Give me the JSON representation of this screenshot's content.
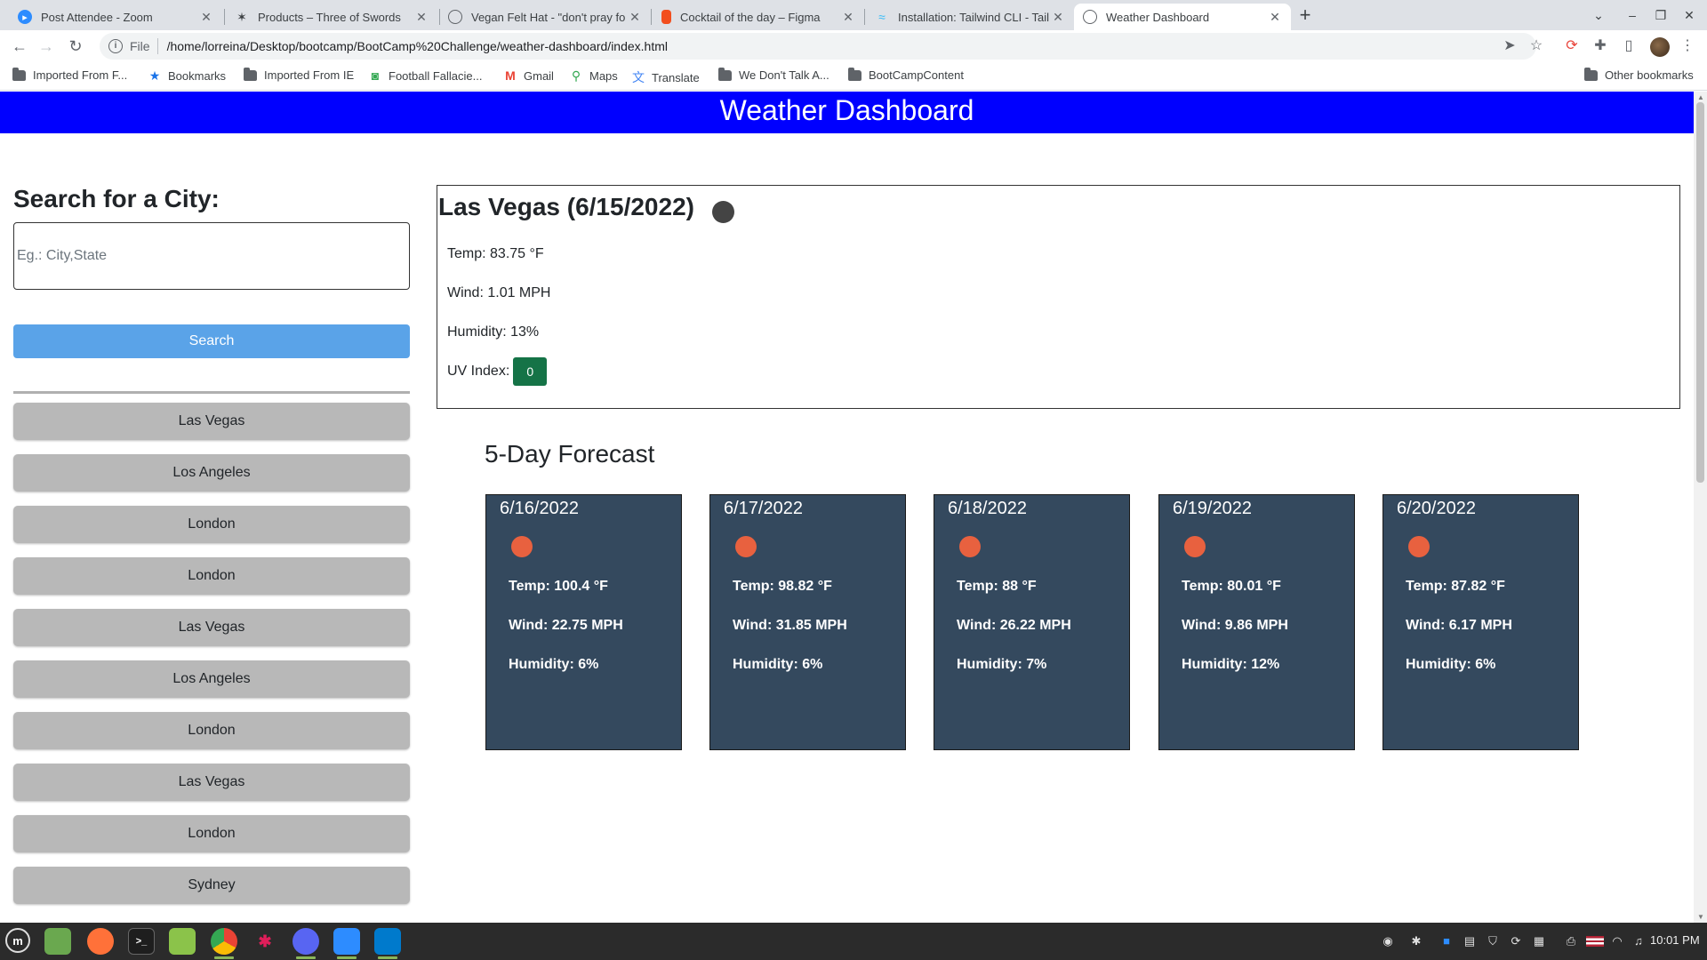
{
  "browser": {
    "tabs": [
      {
        "title": "Post Attendee - Zoom",
        "icon": "zoom-icon",
        "color": "#2d8cff",
        "active": false
      },
      {
        "title": "Products – Three of Swords",
        "icon": "swords-icon",
        "color": "#3c4043",
        "active": false
      },
      {
        "title": "Vegan Felt Hat - \"don't pray fo",
        "icon": "globe-icon",
        "color": "#5f6368",
        "active": false
      },
      {
        "title": "Cocktail of the day – Figma",
        "icon": "figma-icon",
        "color": "#f24e1e",
        "active": false
      },
      {
        "title": "Installation: Tailwind CLI - Tail",
        "icon": "tailwind-icon",
        "color": "#38bdf8",
        "active": false
      },
      {
        "title": "Weather Dashboard",
        "icon": "globe-icon",
        "color": "#5f6368",
        "active": true
      }
    ],
    "url_scheme": "File",
    "url": "/home/lorreina/Desktop/bootcamp/BootCamp%20Challenge/weather-dashboard/index.html",
    "bookmarks": [
      {
        "label": "Imported From F...",
        "icon": "folder-icon"
      },
      {
        "label": "Bookmarks",
        "icon": "star-icon"
      },
      {
        "label": "Imported From IE",
        "icon": "folder-icon"
      },
      {
        "label": "Football Fallacie...",
        "icon": "football-icon"
      },
      {
        "label": "Gmail",
        "icon": "gmail-icon"
      },
      {
        "label": "Maps",
        "icon": "maps-icon"
      },
      {
        "label": "Translate",
        "icon": "translate-icon"
      },
      {
        "label": "We Don't Talk A...",
        "icon": "folder-icon"
      },
      {
        "label": "BootCampContent",
        "icon": "folder-icon"
      }
    ],
    "other_bookmarks": "Other bookmarks"
  },
  "page": {
    "header_title": "Weather Dashboard",
    "header_color": "#0000ff",
    "search": {
      "title": "Search for a City:",
      "placeholder": "Eg.: City,State",
      "button_label": "Search"
    },
    "history": [
      "Las Vegas",
      "Los Angeles",
      "London",
      "London",
      "Las Vegas",
      "Los Angeles",
      "London",
      "Las Vegas",
      "London",
      "Sydney"
    ],
    "current": {
      "title": "Las Vegas (6/15/2022)",
      "temp": "Temp: 83.75 °F",
      "wind": "Wind: 1.01 MPH",
      "humidity": "Humidity: 13%",
      "uv_label": "UV Index:",
      "uv_value": "0",
      "uv_color": "#157347"
    },
    "forecast_title": "5-Day Forecast",
    "forecast": [
      {
        "date": "6/16/2022",
        "temp": "Temp: 100.4 °F",
        "wind": "Wind: 22.75 MPH",
        "humidity": "Humidity: 6%"
      },
      {
        "date": "6/17/2022",
        "temp": "Temp: 98.82 °F",
        "wind": "Wind: 31.85 MPH",
        "humidity": "Humidity: 6%"
      },
      {
        "date": "6/18/2022",
        "temp": "Temp: 88 °F",
        "wind": "Wind: 26.22 MPH",
        "humidity": "Humidity: 7%"
      },
      {
        "date": "6/19/2022",
        "temp": "Temp: 80.01 °F",
        "wind": "Wind: 9.86 MPH",
        "humidity": "Humidity: 12%"
      },
      {
        "date": "6/20/2022",
        "temp": "Temp: 87.82 °F",
        "wind": "Wind: 6.17 MPH",
        "humidity": "Humidity: 6%"
      }
    ]
  },
  "taskbar": {
    "apps": [
      {
        "name": "files-app-icon",
        "color": "#6aa84f"
      },
      {
        "name": "firefox-icon",
        "color": "#ff7139"
      },
      {
        "name": "terminal-icon",
        "color": "#1e1e1e"
      },
      {
        "name": "folder-app-icon",
        "color": "#8bc34a"
      },
      {
        "name": "chrome-icon",
        "color": "#4285f4"
      },
      {
        "name": "slack-icon",
        "color": "#4a154b"
      },
      {
        "name": "discord-icon",
        "color": "#5865f2"
      },
      {
        "name": "zoom-app-icon",
        "color": "#2d8cff"
      },
      {
        "name": "vscode-icon",
        "color": "#007acc"
      }
    ],
    "clock": "10:01 PM"
  }
}
